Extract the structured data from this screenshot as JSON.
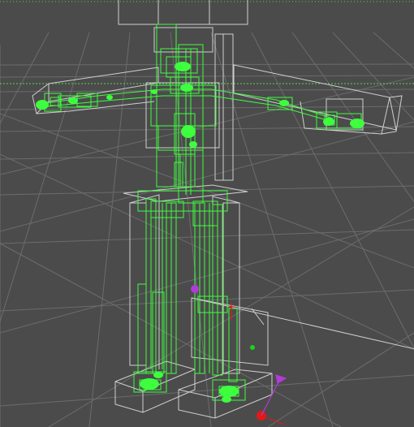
{
  "viewport": {
    "projection": "perspective",
    "grid": true,
    "shading": "wireframe"
  },
  "colors": {
    "background": "#4b4b4b",
    "grid": "#6c6c6c",
    "mesh": "#cfcfcf",
    "bones": "#3dff3d",
    "bones_dark": "#1fb81f",
    "horizon": "#55d455",
    "manipulator_purple": "#b13ad8",
    "manipulator_red": "#e01919",
    "manipulator_green": "#1bd11b"
  },
  "icons": [
    "move-gizmo-icon"
  ]
}
